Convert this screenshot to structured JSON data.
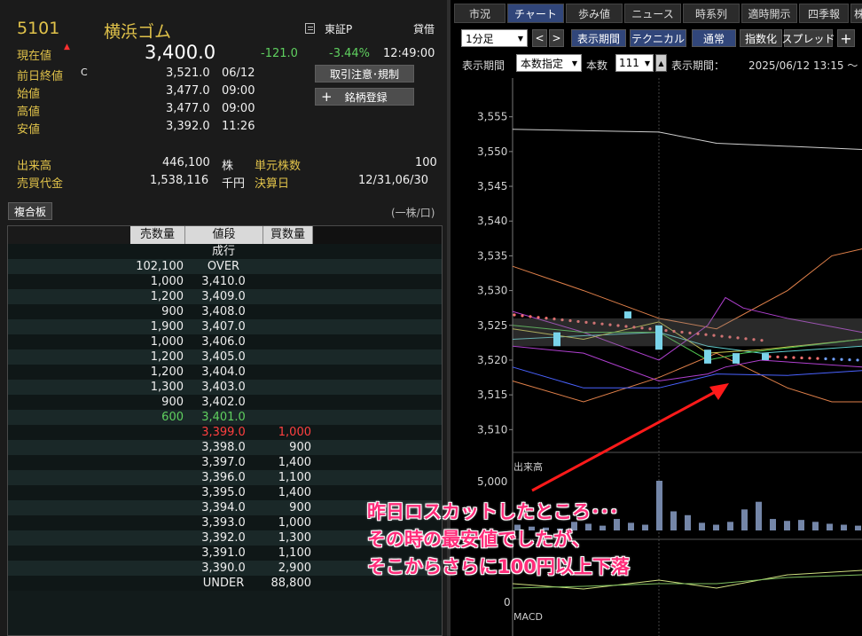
{
  "stock": {
    "code": "5101",
    "name": "横浜ゴム",
    "market": "東証P",
    "margin": "貸借",
    "price_label": "現在値",
    "price": "3,400.0",
    "change": "-121.0",
    "change_pct": "-3.44%",
    "time": "12:49:00"
  },
  "details": {
    "prev_label": "前日終値",
    "prev_mark": "C",
    "prev_value": "3,521.0",
    "prev_date": "06/12",
    "open_label": "始値",
    "open_value": "3,477.0",
    "open_time": "09:00",
    "high_label": "高値",
    "high_value": "3,477.0",
    "high_time": "09:00",
    "low_label": "安値",
    "low_value": "3,392.0",
    "low_time": "11:26"
  },
  "buttons": {
    "caution": "取引注意･規制",
    "register": "銘柄登録",
    "register_plus": "+"
  },
  "volume": {
    "volume_label": "出来高",
    "volume_value": "446,100",
    "volume_unit": "株",
    "unit_label": "単元株数",
    "unit_value": "100",
    "turnover_label": "売買代金",
    "turnover_value": "1,538,116",
    "turnover_unit": "千円",
    "settle_label": "決算日",
    "settle_value": "12/31,06/30"
  },
  "board": {
    "tab": "複合板",
    "unit_note": "(一株/口)",
    "headers": [
      "売数量",
      "値段",
      "買数量"
    ],
    "rows": [
      {
        "sell": "",
        "price": "成行",
        "buy": "",
        "type": "plain"
      },
      {
        "sell": "102,100",
        "price": "OVER",
        "buy": "",
        "type": "plain"
      },
      {
        "sell": "1,000",
        "price": "3,410.0",
        "buy": "",
        "type": "plain"
      },
      {
        "sell": "1,200",
        "price": "3,409.0",
        "buy": "",
        "type": "plain"
      },
      {
        "sell": "900",
        "price": "3,408.0",
        "buy": "",
        "type": "plain"
      },
      {
        "sell": "1,900",
        "price": "3,407.0",
        "buy": "",
        "type": "plain"
      },
      {
        "sell": "1,000",
        "price": "3,406.0",
        "buy": "",
        "type": "plain"
      },
      {
        "sell": "1,200",
        "price": "3,405.0",
        "buy": "",
        "type": "plain"
      },
      {
        "sell": "1,200",
        "price": "3,404.0",
        "buy": "",
        "type": "plain"
      },
      {
        "sell": "1,300",
        "price": "3,403.0",
        "buy": "",
        "type": "plain"
      },
      {
        "sell": "900",
        "price": "3,402.0",
        "buy": "",
        "type": "plain"
      },
      {
        "sell": "600",
        "price": "3,401.0",
        "buy": "",
        "type": "green"
      },
      {
        "sell": "",
        "price": "3,399.0",
        "buy": "1,000",
        "type": "red"
      },
      {
        "sell": "",
        "price": "3,398.0",
        "buy": "900",
        "type": "plain"
      },
      {
        "sell": "",
        "price": "3,397.0",
        "buy": "1,400",
        "type": "plain"
      },
      {
        "sell": "",
        "price": "3,396.0",
        "buy": "1,100",
        "type": "plain"
      },
      {
        "sell": "",
        "price": "3,395.0",
        "buy": "1,400",
        "type": "plain"
      },
      {
        "sell": "",
        "price": "3,394.0",
        "buy": "900",
        "type": "plain"
      },
      {
        "sell": "",
        "price": "3,393.0",
        "buy": "1,000",
        "type": "plain"
      },
      {
        "sell": "",
        "price": "3,392.0",
        "buy": "1,300",
        "type": "plain"
      },
      {
        "sell": "",
        "price": "3,391.0",
        "buy": "1,100",
        "type": "plain"
      },
      {
        "sell": "",
        "price": "3,390.0",
        "buy": "2,900",
        "type": "plain"
      },
      {
        "sell": "",
        "price": "UNDER",
        "buy": "88,800",
        "type": "plain"
      }
    ]
  },
  "tabs": [
    {
      "label": "市況",
      "active": false
    },
    {
      "label": "チャート",
      "active": true
    },
    {
      "label": "歩み値",
      "active": false
    },
    {
      "label": "ニュース",
      "active": false
    },
    {
      "label": "時系列",
      "active": false
    },
    {
      "label": "適時開示",
      "active": false
    },
    {
      "label": "四季報",
      "active": false
    },
    {
      "label": "株",
      "active": false
    }
  ],
  "toolbar": {
    "interval": "1分足",
    "prev": "<",
    "next": ">",
    "display_period": "表示期間",
    "technical": "テクニカル",
    "normal": "通常",
    "indexed": "指数化",
    "spread": "スプレッド",
    "add": "+",
    "period_label": "表示期間",
    "period_select": "本数指定",
    "count_label": "本数",
    "count_value": "111",
    "range_label": "表示期間：",
    "range_value": "2025/06/12 13:15 ～"
  },
  "chart_data": {
    "type": "candlestick",
    "price_axis": [
      "3,555",
      "3,550",
      "3,545",
      "3,540",
      "3,535",
      "3,530",
      "3,525",
      "3,520",
      "3,515",
      "3,510"
    ],
    "ylim": [
      3508,
      3557
    ],
    "volume_label": "出来高",
    "volume_axis": [
      "5,000"
    ],
    "volume_ylim": [
      0,
      6500
    ],
    "volume_values": [
      600,
      400,
      300,
      200,
      900,
      700,
      500,
      1200,
      800,
      600,
      5200,
      2000,
      1600,
      800,
      600,
      900,
      2200,
      3000,
      1200,
      1000,
      1100,
      900,
      700,
      600,
      500
    ],
    "macd_label": "MACD",
    "macd_axis": [
      "0"
    ]
  },
  "annotation": {
    "line1": "昨日ロスカットしたところ･･･",
    "line2": "その時の最安値でしたが、",
    "line3": "そこからさらに100円以上下落"
  },
  "colors": {
    "accent_yellow": "#e0c24a",
    "down_green": "#5fd05f",
    "up_red": "#ff4040",
    "annotation_pink": "#ff2d7a",
    "arrow_red": "#ff1a1a"
  }
}
